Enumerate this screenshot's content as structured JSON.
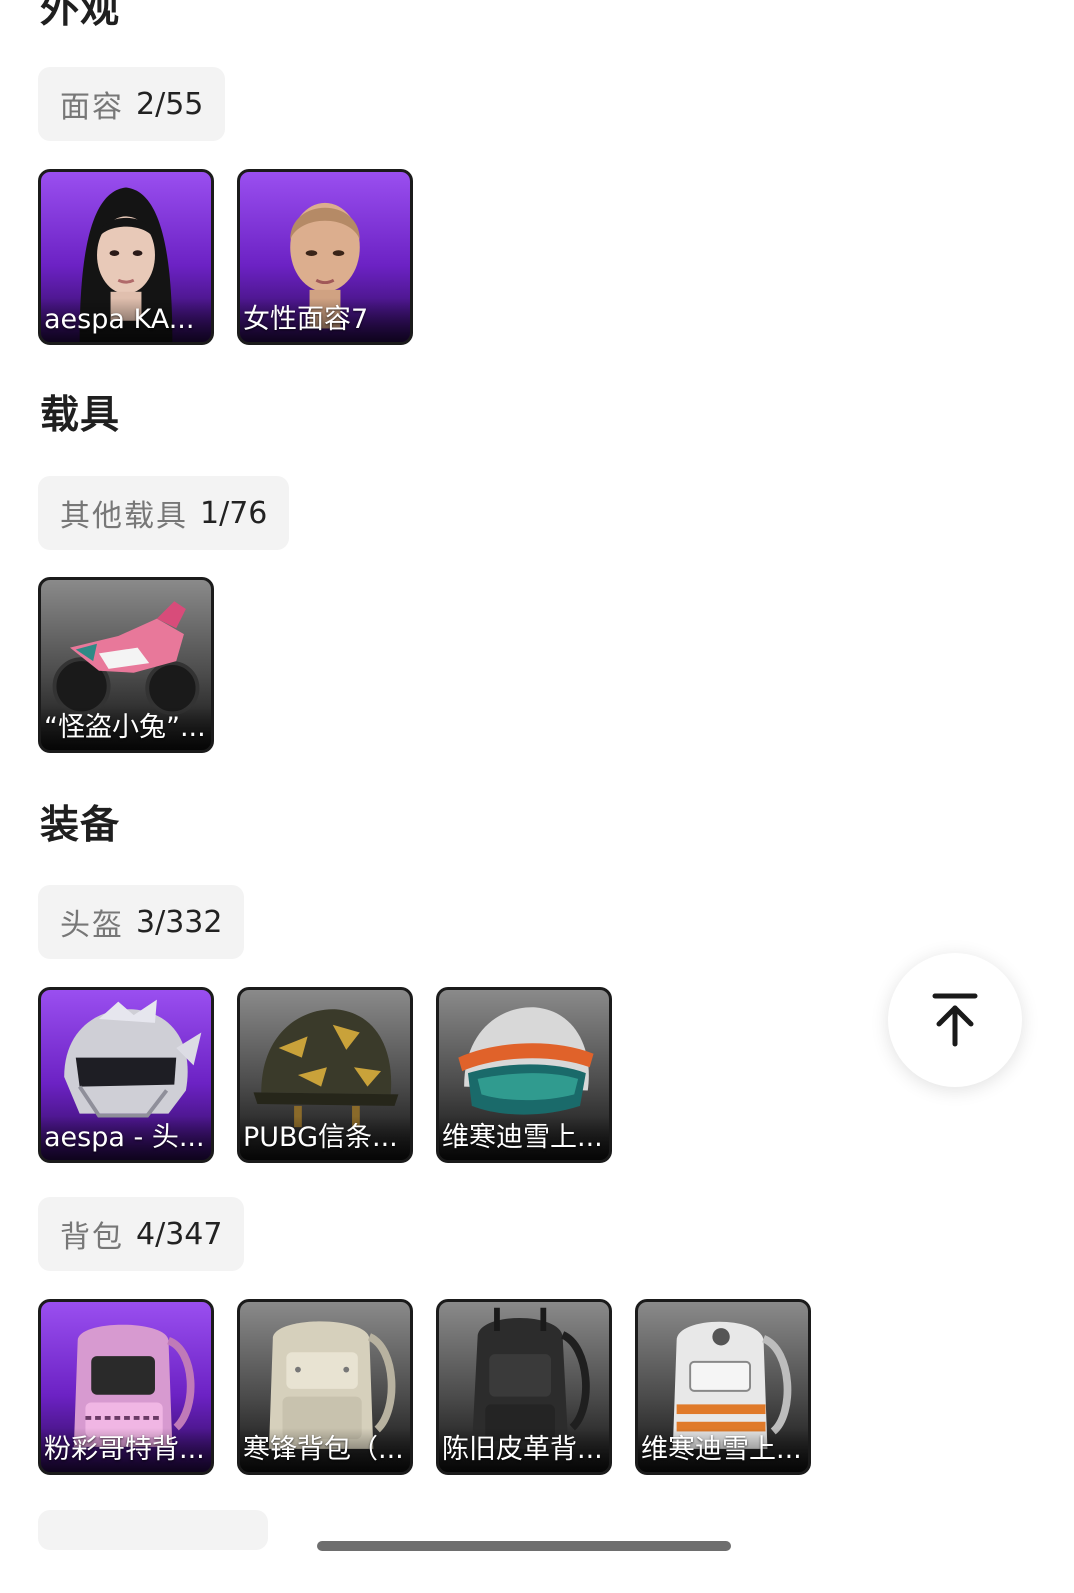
{
  "sections": {
    "appearance": {
      "title": "外观",
      "groups": [
        {
          "category": "面容",
          "count": "2/55",
          "items": [
            {
              "label": "aespa KA..."
            },
            {
              "label": "女性面容7"
            }
          ]
        }
      ]
    },
    "vehicles": {
      "title": "载具",
      "groups": [
        {
          "category": "其他载具",
          "count": "1/76",
          "items": [
            {
              "label": "“怪盗小兔”..."
            }
          ]
        }
      ]
    },
    "equipment": {
      "title": "装备",
      "groups": [
        {
          "category": "头盔",
          "count": "3/332",
          "items": [
            {
              "label": "aespa - 头..."
            },
            {
              "label": "PUBG信条..."
            },
            {
              "label": "维寒迪雪上..."
            }
          ]
        },
        {
          "category": "背包",
          "count": "4/347",
          "items": [
            {
              "label": "粉彩哥特背..."
            },
            {
              "label": "寒锋背包（..."
            },
            {
              "label": "陈旧皮革背..."
            },
            {
              "label": "维寒迪雪上..."
            }
          ]
        }
      ]
    }
  },
  "rarity_colors": {
    "purple": "#7a2fd6",
    "gray": "#555555"
  },
  "scroll_top": {
    "icon": "arrow-up-to-top-icon"
  }
}
